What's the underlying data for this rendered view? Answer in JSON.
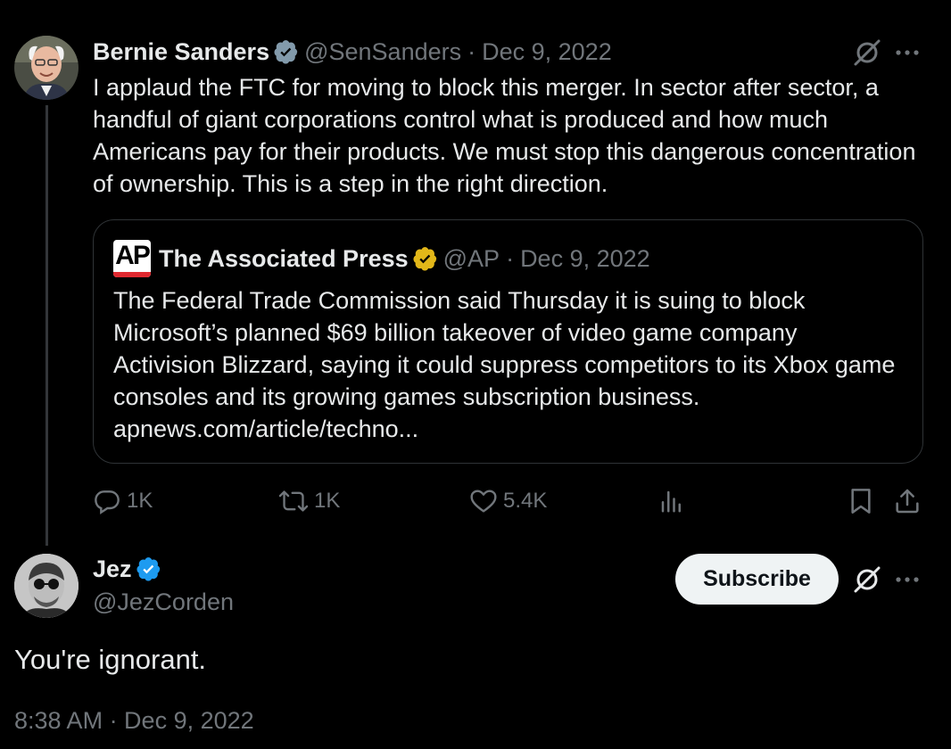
{
  "tweet": {
    "author": {
      "name": "Bernie Sanders",
      "handle": "@SenSanders",
      "verified": true,
      "verified_color": "#829aab"
    },
    "separator": "·",
    "date": "Dec 9, 2022",
    "text": "I applaud the FTC for moving to block this merger. In sector after sector, a handful of giant corporations control what is produced and how much Americans pay for their products. We must stop this dangerous concentration of ownership. This is a step in the right direction.",
    "quoted": {
      "logo_text": "AP",
      "author_name": "The Associated Press",
      "verified_color": "#e2b719",
      "handle": "@AP",
      "separator": "·",
      "date": "Dec 9, 2022",
      "text": "The Federal Trade Commission said Thursday it is suing to block Microsoft’s planned $69 billion takeover of video game company Activision Blizzard, saying it could suppress competitors to its Xbox game consoles and its growing games subscription business.",
      "link": "apnews.com/article/techno..."
    },
    "actions": {
      "replies": "1K",
      "reposts": "1K",
      "likes": "5.4K",
      "views_icon": "views-icon",
      "bookmark_icon": "bookmark-icon",
      "share_icon": "share-icon"
    }
  },
  "reply": {
    "author": {
      "name": "Jez",
      "handle": "@JezCorden",
      "verified": true,
      "verified_color": "#1d9bf0"
    },
    "subscribe_label": "Subscribe",
    "text": "You're ignorant.",
    "timestamp": "8:38 AM · Dec 9, 2022"
  },
  "colors": {
    "background": "#000000",
    "text": "#e7e9ea",
    "muted": "#71767b",
    "border": "#2f3336"
  }
}
